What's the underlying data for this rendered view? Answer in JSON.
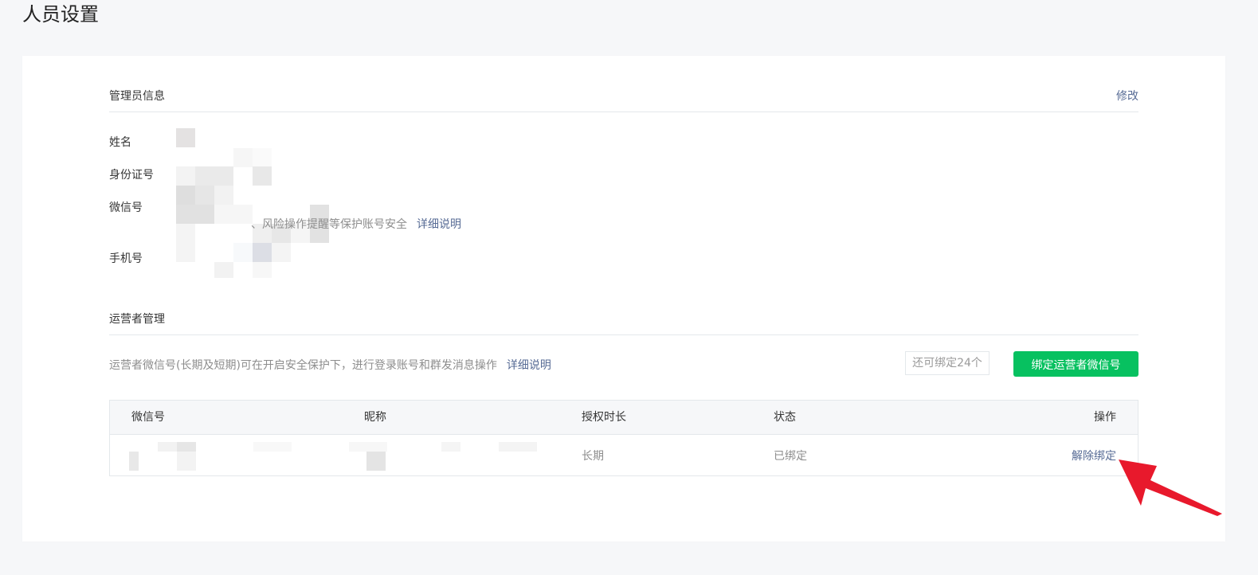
{
  "page": {
    "title": "人员设置"
  },
  "admin": {
    "section_title": "管理员信息",
    "edit_label": "修改",
    "fields": {
      "name_label": "姓名",
      "id_label": "身份证号",
      "wechat_label": "微信号",
      "phone_label": "手机号"
    },
    "wechat_note": "、风险操作提醒等保护账号安全",
    "wechat_detail_link": "详细说明"
  },
  "operators": {
    "section_title": "运营者管理",
    "description": "运营者微信号(长期及短期)可在开启安全保护下，进行登录账号和群发消息操作",
    "detail_link": "详细说明",
    "remaining": "还可绑定24个",
    "bind_button": "绑定运营者微信号",
    "table": {
      "headers": [
        "微信号",
        "昵称",
        "授权时长",
        "状态",
        "操作"
      ],
      "rows": [
        {
          "duration": "长期",
          "status": "已绑定",
          "action": "解除绑定"
        }
      ]
    }
  },
  "colors": {
    "accent_green": "#07c160",
    "link_blue": "#576b95",
    "annotation_red": "#e8192c"
  }
}
